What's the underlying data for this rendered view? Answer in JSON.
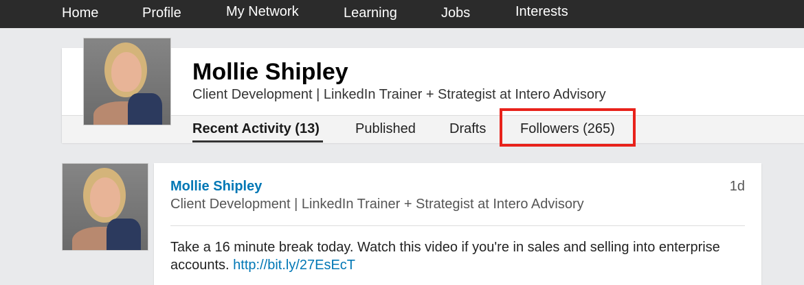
{
  "topnav": {
    "items": [
      "Home",
      "Profile",
      "My Network",
      "Learning",
      "Jobs",
      "Interests"
    ]
  },
  "profile": {
    "name": "Mollie Shipley",
    "headline": "Client Development | LinkedIn Trainer + Strategist at Intero Advisory",
    "avatar_icon": "profile-photo",
    "tabs": [
      {
        "label": "Recent Activity (13)",
        "active": true
      },
      {
        "label": "Published",
        "active": false
      },
      {
        "label": "Drafts",
        "active": false
      },
      {
        "label": "Followers (265)",
        "active": false,
        "highlighted": true
      }
    ]
  },
  "post": {
    "author": "Mollie Shipley",
    "headline": "Client Development | LinkedIn Trainer + Strategist at Intero Advisory",
    "time": "1d",
    "text": "Take a 16 minute break today. Watch this video if you're in sales and selling into enterprise accounts.",
    "link": "http://bit.ly/27EsEcT"
  },
  "colors": {
    "nav_bg": "#2b2b2b",
    "link_blue": "#0077b5",
    "highlight_red": "#e8221b",
    "page_bg": "#e9eaec"
  }
}
